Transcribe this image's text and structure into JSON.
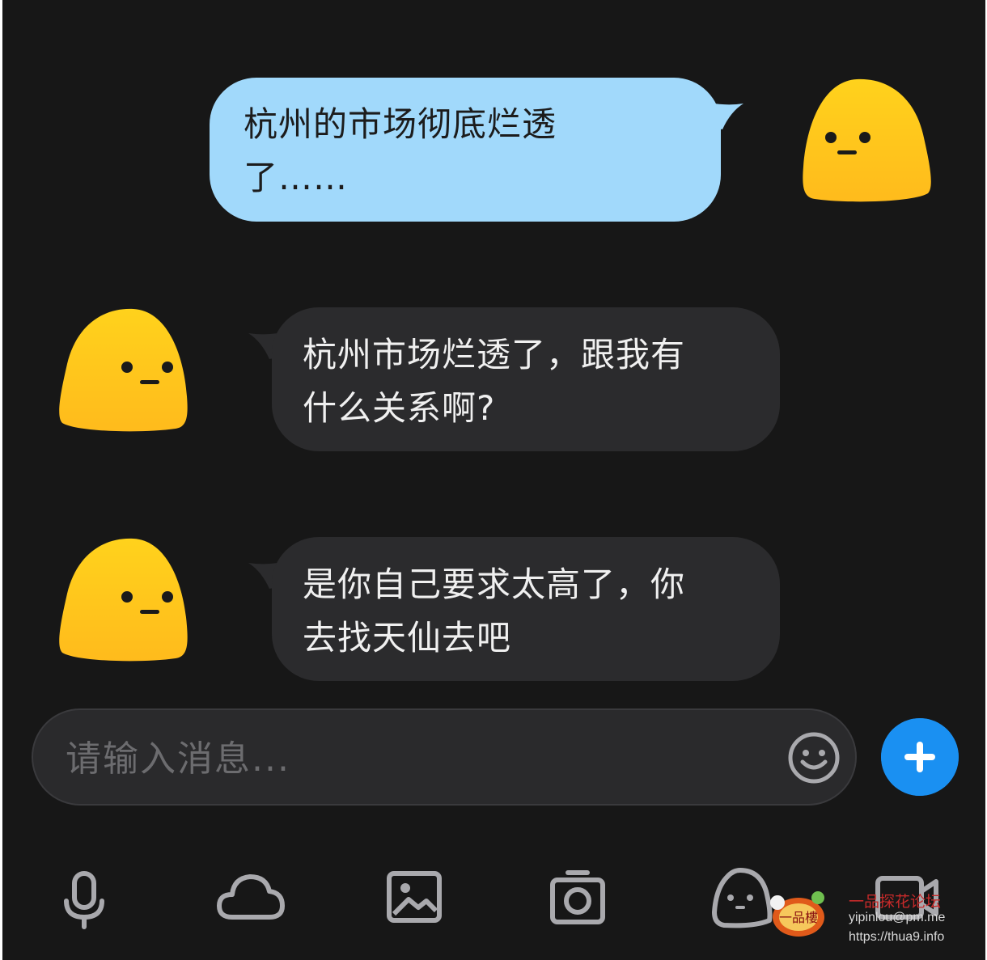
{
  "messages": [
    {
      "side": "out",
      "text": "杭州的市场彻底烂透了……",
      "lines": [
        "杭州的市场彻底烂透",
        "了……"
      ]
    },
    {
      "side": "in",
      "text": "杭州市场烂透了，跟我有什么关系啊?",
      "lines": [
        "杭州市场烂透了，跟我有",
        "什么关系啊?"
      ]
    },
    {
      "side": "in",
      "text": "是你自己要求太高了，你去找天仙去吧",
      "lines": [
        "是你自己要求太高了，你",
        "去找天仙去吧"
      ]
    }
  ],
  "input": {
    "placeholder": "请输入消息..."
  },
  "icons": {
    "emoji": "smiley-face-icon",
    "plus": "plus-icon",
    "toolbar": [
      "microphone-icon",
      "cloud-icon",
      "image-icon",
      "camera-icon",
      "sticker-face-icon",
      "video-call-icon"
    ]
  },
  "colors": {
    "background": "#171717",
    "outgoing_bubble": "#a1d9fb",
    "incoming_bubble": "#2b2b2d",
    "accent": "#1a90f2",
    "avatar_top": "#ffd21c",
    "avatar_bottom": "#ffbb1c"
  },
  "watermark": {
    "title": "一品探花论坛",
    "email": "yipinlou@pm.me",
    "url": "https://thua9.info",
    "logo_text": "一品樓"
  }
}
